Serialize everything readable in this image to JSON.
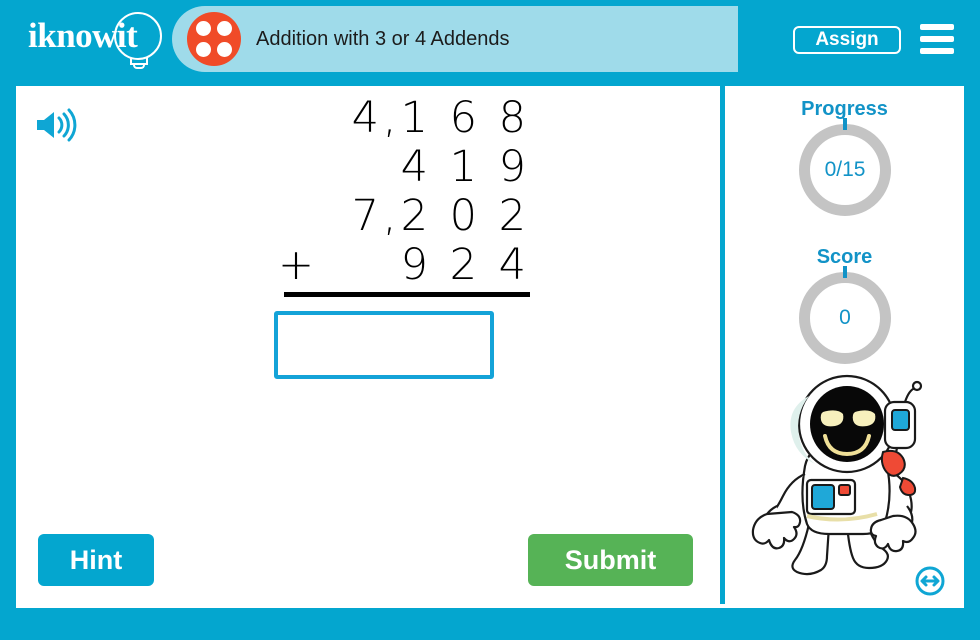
{
  "header": {
    "logo_text": "iknowit",
    "logo_icon": "lightbulb-icon",
    "lesson_icon": "dice-four-icon",
    "title": "Addition with 3 or 4 Addends",
    "assign_label": "Assign",
    "menu_icon": "hamburger-menu-icon",
    "bg_color": "#04a6cf",
    "pill_color": "#9fdbea",
    "dice_color": "#f04b28"
  },
  "problem": {
    "audio_icon": "speaker-icon",
    "addends": [
      "4,1 6 8",
      "4 1 9",
      "7,2 0 2",
      "9 2 4"
    ],
    "operator": "+",
    "answer_value": "",
    "answer_placeholder": ""
  },
  "actions": {
    "hint_label": "Hint",
    "hint_color": "#04a6cf",
    "submit_label": "Submit",
    "submit_color": "#56b356"
  },
  "sidebar": {
    "progress_label": "Progress",
    "progress_value": "0/15",
    "score_label": "Score",
    "score_value": "0",
    "ring_color": "#c4c4c4",
    "accent_color": "#1293c7",
    "mascot_icon": "astronaut-mascot",
    "resize_icon": "resize-horizontal-icon"
  }
}
